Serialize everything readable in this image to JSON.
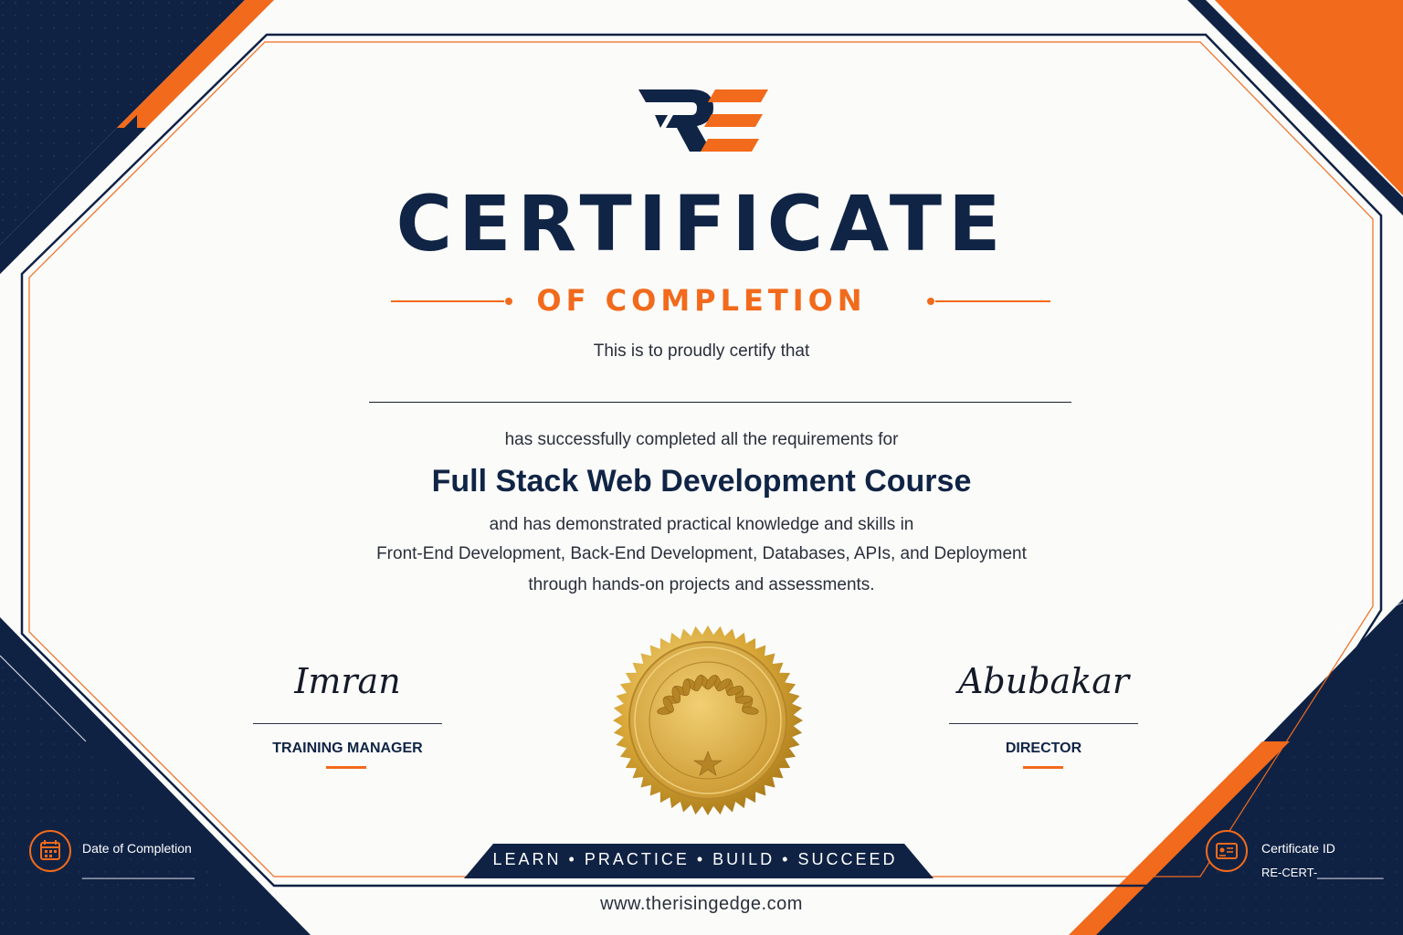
{
  "logo": {
    "text": "RE",
    "primary_color": "#102445",
    "accent_color": "#f26a1b"
  },
  "heading": {
    "title": "CERTIFICATE",
    "subtitle": "OF COMPLETION"
  },
  "body": {
    "intro": "This is to proudly certify that",
    "requirements": "has successfully completed all the requirements for",
    "course": "Full Stack Web Development Course",
    "description": [
      "and has demonstrated practical knowledge and skills in",
      "Front-End Development, Back-End Development, Databases, APIs, and Deployment",
      "through hands-on projects and assessments."
    ]
  },
  "signatures": {
    "left": {
      "script": "Imran",
      "title": "TRAINING MANAGER"
    },
    "right": {
      "script": "Abubakar",
      "title": "DIRECTOR"
    }
  },
  "seal": {
    "icon": "gold-seal-laurel-star",
    "color": "#d4a437"
  },
  "footer": {
    "tagline": "LEARN • PRACTICE • BUILD • SUCCEED",
    "website": "www.therisingedge.com",
    "date": {
      "icon": "calendar-icon",
      "label": "Date of Completion",
      "value": "_________________"
    },
    "certificate_id": {
      "icon": "id-card-icon",
      "label": "Certificate ID",
      "value": "RE-CERT-__________"
    }
  },
  "colors": {
    "navy": "#0f2244",
    "orange": "#f26a1b",
    "gold": "#d4a437"
  }
}
